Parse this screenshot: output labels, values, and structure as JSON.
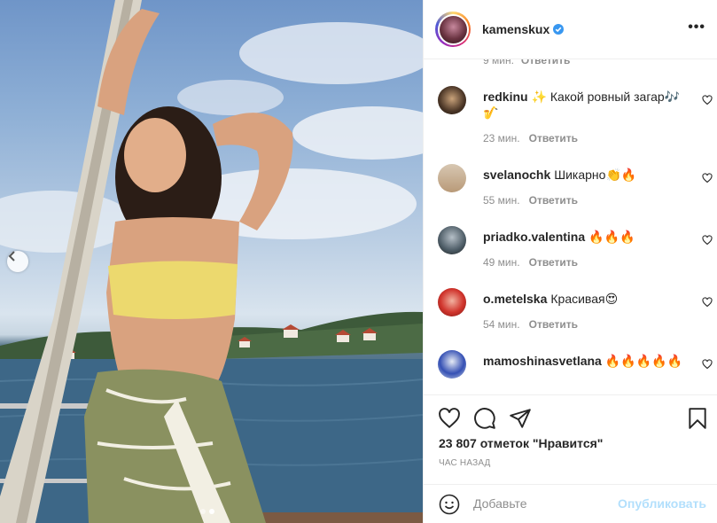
{
  "post": {
    "username": "kamenskux",
    "more_label": "•••"
  },
  "comments": {
    "partial_time": "9 мин.",
    "partial_reply": "Ответить",
    "items": [
      {
        "user": "redkinu",
        "text": "✨ Какой ровный загар🎶🎷",
        "time": "23 мин.",
        "reply": "Ответить"
      },
      {
        "user": "svelanochk",
        "text": "Шикарно👏🔥",
        "time": "55 мин.",
        "reply": "Ответить"
      },
      {
        "user": "priadko.valentina",
        "text": "🔥🔥🔥",
        "time": "49 мин.",
        "reply": "Ответить"
      },
      {
        "user": "o.metelska",
        "text": "Красивая😍",
        "time": "54 мин.",
        "reply": "Ответить"
      },
      {
        "user": "mamoshinasvetlana",
        "text": "🔥🔥🔥🔥🔥",
        "time": "",
        "reply": ""
      }
    ]
  },
  "actions": {
    "likes": "23 807 отметок \"Нравится\"",
    "timestamp": "ЧАС НАЗАД"
  },
  "add_comment": {
    "placeholder": "Добавьте",
    "publish_label": "Опубликовать"
  },
  "icons": {
    "verified": "verified-badge-icon",
    "more": "more-options-icon",
    "heart": "heart-icon",
    "comment": "comment-icon",
    "share": "share-icon",
    "save": "bookmark-icon",
    "emoji": "emoji-icon",
    "prev": "chevron-left-icon"
  },
  "colors": {
    "accent_blue": "#0095f6",
    "publish_disabled": "#b2dffc",
    "secondary_text": "#8e8e8e",
    "primary_text": "#262626"
  }
}
